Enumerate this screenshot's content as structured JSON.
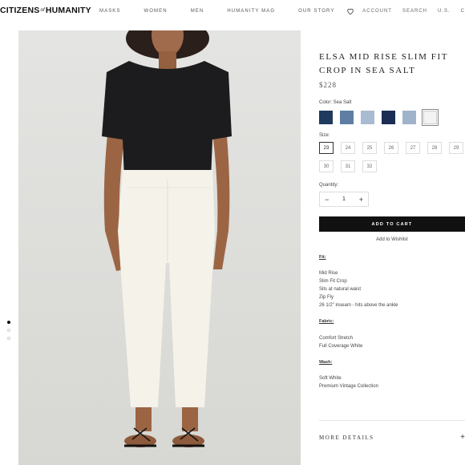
{
  "header": {
    "logo_left": "CITIZENS",
    "logo_of": "of",
    "logo_right": "HUMANITY",
    "nav": [
      "MASKS",
      "WOMEN",
      "MEN",
      "HUMANITY MAG",
      "OUR STORY"
    ],
    "account": "ACCOUNT",
    "search": "SEARCH",
    "region": "U.S.",
    "cart_initial": "C"
  },
  "gallery": {
    "total": 3,
    "active_index": 0
  },
  "product": {
    "title": "ELSA MID RISE SLIM FIT CROP IN SEA SALT",
    "price": "$228",
    "color_label": "Color: Sea Salt",
    "swatches": [
      "#1e3a5c",
      "#5e7fa3",
      "#a9bbd0",
      "#1b2d52",
      "#9fb3cb",
      "#f3f3f3"
    ],
    "selected_swatch": 5,
    "size_label": "Size:",
    "sizes": [
      "23",
      "24",
      "25",
      "26",
      "27",
      "28",
      "29",
      "30",
      "31",
      "32"
    ],
    "selected_size": "23",
    "quantity_label": "Quantity:",
    "quantity": "1",
    "minus": "−",
    "plus": "+",
    "add_to_cart": "ADD TO CART",
    "wishlist": "Add to Wishlist"
  },
  "details": {
    "fit_heading": "Fit:",
    "fit_lines": [
      "Mid Rise",
      "Slim Fit Crop",
      "Sits at natural waist",
      "Zip Fly",
      "26 1/2\" inseam - hits above the ankle"
    ],
    "fabric_heading": "Fabric:",
    "fabric_lines": [
      "Comfort Stretch",
      "Full Coverage White"
    ],
    "wash_heading": "Wash:",
    "wash_lines": [
      "Soft White",
      "Premium Vintage Collection"
    ],
    "more_details": "MORE DETAILS",
    "more_icon": "+"
  },
  "colors": {
    "accent": "#111111",
    "photo_bg": "#dedddb"
  }
}
